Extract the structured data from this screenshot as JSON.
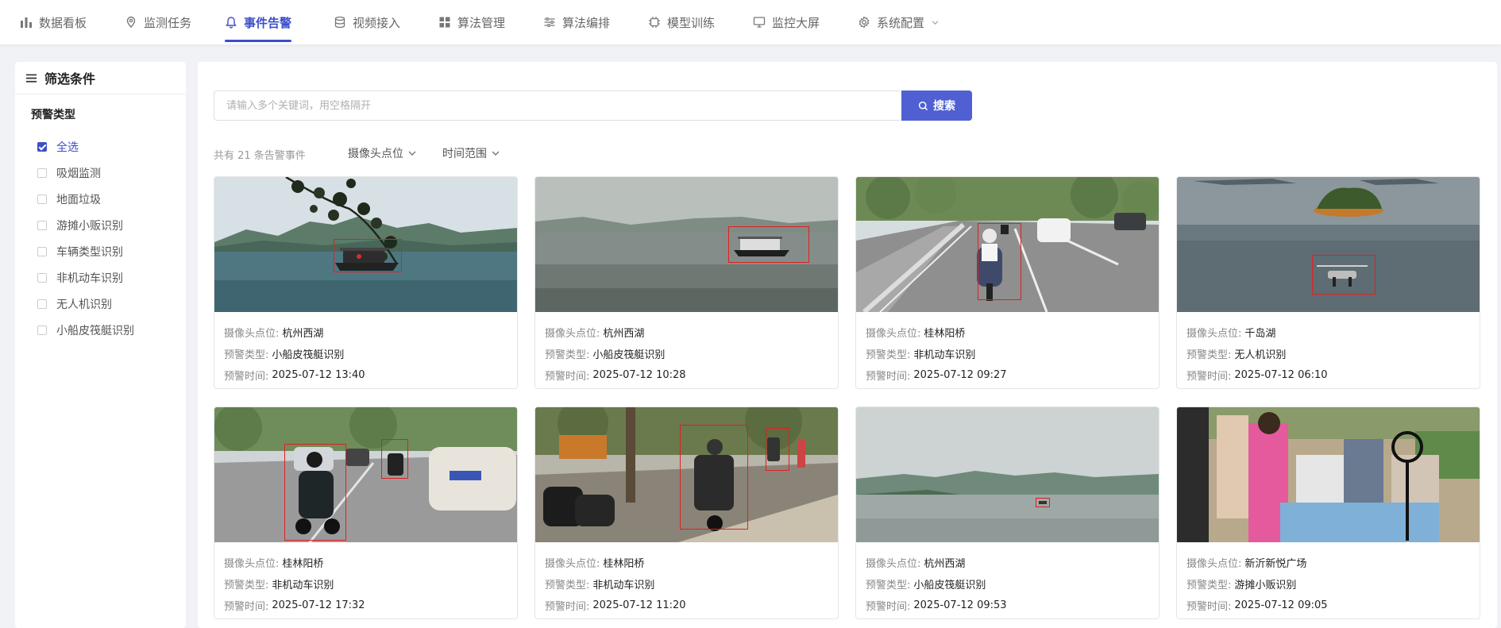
{
  "nav": {
    "items": [
      {
        "label": "数据看板",
        "icon": "bar-chart-icon"
      },
      {
        "label": "监测任务",
        "icon": "location-pin-icon"
      },
      {
        "label": "事件告警",
        "icon": "bell-icon",
        "active": true
      },
      {
        "label": "视频接入",
        "icon": "database-icon"
      },
      {
        "label": "算法管理",
        "icon": "grid-icon"
      },
      {
        "label": "算法编排",
        "icon": "sliders-icon"
      },
      {
        "label": "模型训练",
        "icon": "chip-icon"
      },
      {
        "label": "监控大屏",
        "icon": "monitor-icon"
      },
      {
        "label": "系统配置",
        "icon": "gear-icon",
        "has_dropdown": true
      }
    ]
  },
  "sidebar": {
    "title": "筛选条件",
    "section_title": "预警类型",
    "options": [
      {
        "label": "全选",
        "checked": true
      },
      {
        "label": "吸烟监测",
        "checked": false
      },
      {
        "label": "地面垃圾",
        "checked": false
      },
      {
        "label": "游摊小贩识别",
        "checked": false
      },
      {
        "label": "车辆类型识别",
        "checked": false
      },
      {
        "label": "非机动车识别",
        "checked": false
      },
      {
        "label": "无人机识别",
        "checked": false
      },
      {
        "label": "小船皮筏艇识别",
        "checked": false
      }
    ]
  },
  "search": {
    "placeholder": "请输入多个关键词，用空格隔开",
    "value": "",
    "button_label": "搜索"
  },
  "toolbar": {
    "count_text": "共有 21 条告警事件",
    "camera_filter_label": "摄像头点位",
    "time_filter_label": "时间范围"
  },
  "card_labels": {
    "camera": "摄像头点位:",
    "type": "预警类型:",
    "time": "预警时间:"
  },
  "events": [
    {
      "camera": "杭州西湖",
      "type": "小船皮筏艇识别",
      "time": "2025-07-12 13:40",
      "scene": "lake-boat-branches"
    },
    {
      "camera": "杭州西湖",
      "type": "小船皮筏艇识别",
      "time": "2025-07-12 10:28",
      "scene": "lake-boat-haze"
    },
    {
      "camera": "桂林阳桥",
      "type": "非机动车识别",
      "time": "2025-07-12 09:27",
      "scene": "road-scooter"
    },
    {
      "camera": "千岛湖",
      "type": "无人机识别",
      "time": "2025-07-12 06:10",
      "scene": "lake-drone"
    },
    {
      "camera": "桂林阳桥",
      "type": "非机动车识别",
      "time": "2025-07-12 17:32",
      "scene": "street-scooters"
    },
    {
      "camera": "桂林阳桥",
      "type": "非机动车识别",
      "time": "2025-07-12 11:20",
      "scene": "sidewalk-scooter"
    },
    {
      "camera": "杭州西湖",
      "type": "小船皮筏艇识别",
      "time": "2025-07-12 09:53",
      "scene": "lake-distant-boat"
    },
    {
      "camera": "新沂新悦广场",
      "type": "游摊小贩识别",
      "time": "2025-07-12 09:05",
      "scene": "market-vendors"
    }
  ],
  "colors": {
    "accent": "#3d4ec9",
    "button": "#5060d3",
    "detection_box": "#e02020",
    "page_bg": "#f0f2f5"
  }
}
